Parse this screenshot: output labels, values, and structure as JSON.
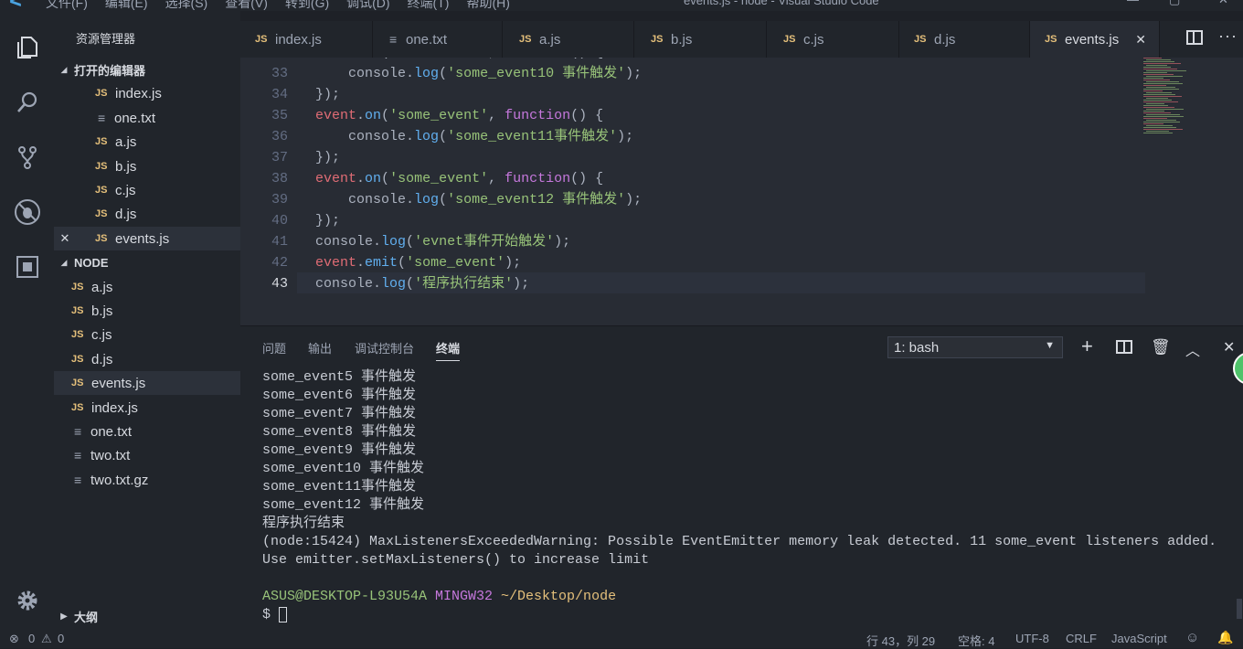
{
  "window": {
    "title": "events.js - node - Visual Studio Code",
    "menu": [
      "文件(F)",
      "编辑(E)",
      "选择(S)",
      "查看(V)",
      "转到(G)",
      "调试(D)",
      "终端(T)",
      "帮助(H)"
    ]
  },
  "sidebar": {
    "title": "资源管理器",
    "open_editors_label": "打开的编辑器",
    "open_editors": [
      {
        "name": "index.js",
        "type": "js"
      },
      {
        "name": "one.txt",
        "type": "txt"
      },
      {
        "name": "a.js",
        "type": "js"
      },
      {
        "name": "b.js",
        "type": "js"
      },
      {
        "name": "c.js",
        "type": "js"
      },
      {
        "name": "d.js",
        "type": "js"
      },
      {
        "name": "events.js",
        "type": "js"
      }
    ],
    "folder_label": "NODE",
    "files": [
      {
        "name": "a.js",
        "type": "js"
      },
      {
        "name": "b.js",
        "type": "js"
      },
      {
        "name": "c.js",
        "type": "js"
      },
      {
        "name": "d.js",
        "type": "js"
      },
      {
        "name": "events.js",
        "type": "js"
      },
      {
        "name": "index.js",
        "type": "js"
      },
      {
        "name": "one.txt",
        "type": "txt"
      },
      {
        "name": "two.txt",
        "type": "txt"
      },
      {
        "name": "two.txt.gz",
        "type": "txt"
      }
    ],
    "outline_label": "大纲"
  },
  "tabs": [
    {
      "label": "index.js",
      "type": "js"
    },
    {
      "label": "one.txt",
      "type": "txt"
    },
    {
      "label": "a.js",
      "type": "js"
    },
    {
      "label": "b.js",
      "type": "js"
    },
    {
      "label": "c.js",
      "type": "js"
    },
    {
      "label": "d.js",
      "type": "js"
    },
    {
      "label": "events.js",
      "type": "js",
      "active": true
    }
  ],
  "file_type_badge": "JS",
  "editor": {
    "lines": [
      {
        "n": "33",
        "code": [
          [
            "    ",
            "p"
          ],
          [
            "console",
            "p"
          ],
          [
            ".",
            "p"
          ],
          [
            "log",
            "f"
          ],
          [
            "(",
            "p"
          ],
          [
            "'some_event10 事件触发'",
            "s"
          ],
          [
            ");",
            "p"
          ]
        ]
      },
      {
        "n": "34",
        "code": [
          [
            "});",
            "p"
          ]
        ]
      },
      {
        "n": "35",
        "code": [
          [
            "event",
            "k"
          ],
          [
            ".",
            "p"
          ],
          [
            "on",
            "f"
          ],
          [
            "(",
            "p"
          ],
          [
            "'some_event'",
            "s"
          ],
          [
            ", ",
            "p"
          ],
          [
            "function",
            "kw"
          ],
          [
            "() {",
            "p"
          ]
        ]
      },
      {
        "n": "36",
        "code": [
          [
            "    ",
            "p"
          ],
          [
            "console",
            "p"
          ],
          [
            ".",
            "p"
          ],
          [
            "log",
            "f"
          ],
          [
            "(",
            "p"
          ],
          [
            "'some_event11事件触发'",
            "s"
          ],
          [
            ");",
            "p"
          ]
        ]
      },
      {
        "n": "37",
        "code": [
          [
            "});",
            "p"
          ]
        ]
      },
      {
        "n": "38",
        "code": [
          [
            "event",
            "k"
          ],
          [
            ".",
            "p"
          ],
          [
            "on",
            "f"
          ],
          [
            "(",
            "p"
          ],
          [
            "'some_event'",
            "s"
          ],
          [
            ", ",
            "p"
          ],
          [
            "function",
            "kw"
          ],
          [
            "() {",
            "p"
          ]
        ]
      },
      {
        "n": "39",
        "code": [
          [
            "    ",
            "p"
          ],
          [
            "console",
            "p"
          ],
          [
            ".",
            "p"
          ],
          [
            "log",
            "f"
          ],
          [
            "(",
            "p"
          ],
          [
            "'some_event12 事件触发'",
            "s"
          ],
          [
            ");",
            "p"
          ]
        ]
      },
      {
        "n": "40",
        "code": [
          [
            "});",
            "p"
          ]
        ]
      },
      {
        "n": "41",
        "code": [
          [
            "console",
            "p"
          ],
          [
            ".",
            "p"
          ],
          [
            "log",
            "f"
          ],
          [
            "(",
            "p"
          ],
          [
            "'evnet事件开始触发'",
            "s"
          ],
          [
            ");",
            "p"
          ]
        ]
      },
      {
        "n": "42",
        "code": [
          [
            "event",
            "k"
          ],
          [
            ".",
            "p"
          ],
          [
            "emit",
            "f"
          ],
          [
            "(",
            "p"
          ],
          [
            "'some_event'",
            "s"
          ],
          [
            ");",
            "p"
          ]
        ]
      },
      {
        "n": "43",
        "code": [
          [
            "console",
            "p"
          ],
          [
            ".",
            "p"
          ],
          [
            "log",
            "f"
          ],
          [
            "(",
            "p"
          ],
          [
            "'程序执行结束'",
            "s"
          ],
          [
            ");",
            "p"
          ]
        ]
      }
    ],
    "current_line": "43"
  },
  "panel": {
    "tabs": [
      "问题",
      "输出",
      "调试控制台",
      "终端"
    ],
    "active_tab": "终端",
    "terminal_select": "1: bash",
    "terminal_lines": [
      "some_event5 事件触发",
      "some_event6 事件触发",
      "some_event7 事件触发",
      "some_event8 事件触发",
      "some_event9 事件触发",
      "some_event10 事件触发",
      "some_event11事件触发",
      "some_event12 事件触发",
      "程序执行结束",
      "(node:15424) MaxListenersExceededWarning: Possible EventEmitter memory leak detected. 11 some_event listeners added.",
      "Use emitter.setMaxListeners() to increase limit",
      ""
    ],
    "prompt_user": "ASUS@DESKTOP-L93U54A",
    "prompt_env": "MINGW32",
    "prompt_path": "~/Desktop/node",
    "prompt_symbol": "$"
  },
  "statusbar": {
    "errors": "0",
    "warnings": "0",
    "position": "行 43，列 29",
    "spaces": "空格: 4",
    "encoding": "UTF-8",
    "eol": "CRLF",
    "language": "JavaScript"
  }
}
